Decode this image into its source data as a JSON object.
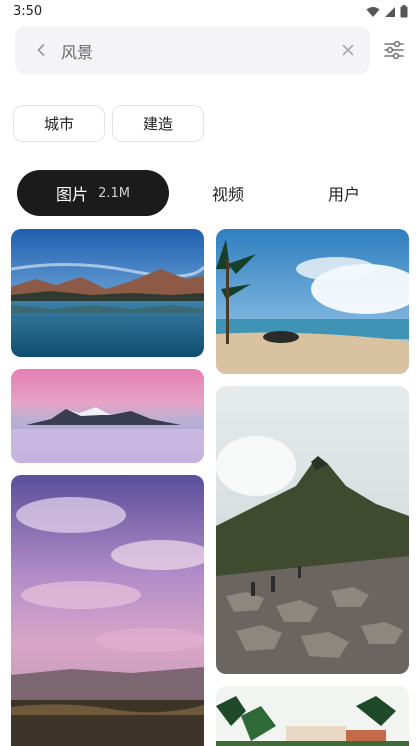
{
  "status_bar": {
    "time": "3:50"
  },
  "search": {
    "query": "风景"
  },
  "suggestions": [
    "城市",
    "建造"
  ],
  "tabs": [
    {
      "label": "图片",
      "count": "2.1M"
    },
    {
      "label": "视频"
    },
    {
      "label": "用户"
    }
  ],
  "colors": {
    "active_tab_bg": "#1b1b1b",
    "search_bg": "#f4f4f6"
  },
  "icons": {
    "back": "chevron-left-icon",
    "clear": "close-icon",
    "filter": "sliders-icon"
  }
}
